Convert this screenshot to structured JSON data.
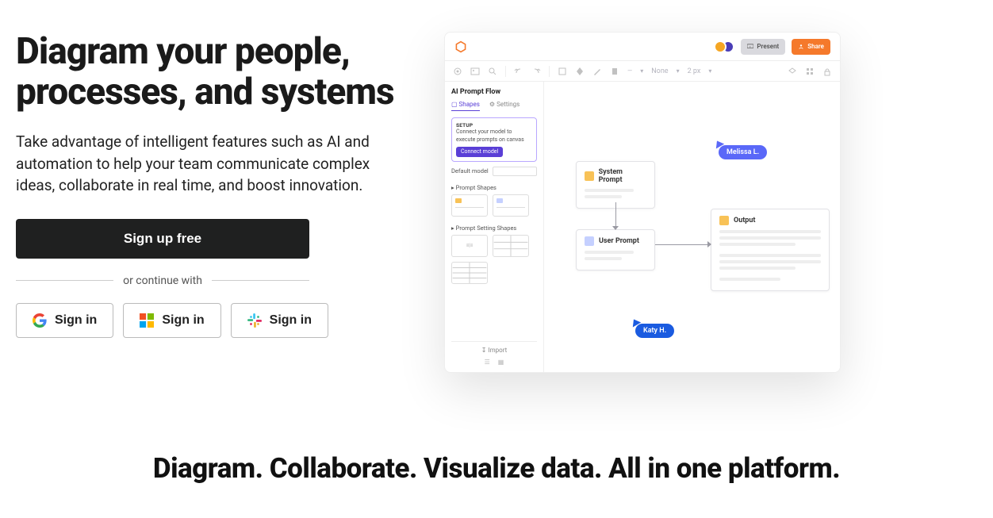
{
  "hero": {
    "headline": "Diagram your people, processes, and systems",
    "subhead": "Take advantage of intelligent features such as AI and automation to help your team communicate complex ideas, collaborate in real time, and boost innovation.",
    "signup_label": "Sign up free",
    "divider": "or continue with",
    "signin_google": "Sign in",
    "signin_microsoft": "Sign in",
    "signin_slack": "Sign in"
  },
  "app": {
    "present_label": "Present",
    "share_label": "Share",
    "toolbar_none": "None",
    "toolbar_px": "2 px",
    "sidebar": {
      "title": "AI Prompt Flow",
      "tab_shapes": "Shapes",
      "tab_settings": "Settings",
      "setup_h": "SETUP",
      "setup_text": "Connect your model to execute prompts on canvas",
      "connect": "Connect model",
      "default_model": "Default model",
      "group1": "Prompt Shapes",
      "group2": "Prompt Setting Shapes",
      "import": "Import"
    },
    "cards": {
      "system": "System Prompt",
      "user": "User Prompt",
      "output": "Output"
    },
    "cursors": {
      "melissa": "Melissa L.",
      "katy": "Katy H."
    }
  },
  "bottom_heading": "Diagram. Collaborate. Visualize data. All in one platform."
}
